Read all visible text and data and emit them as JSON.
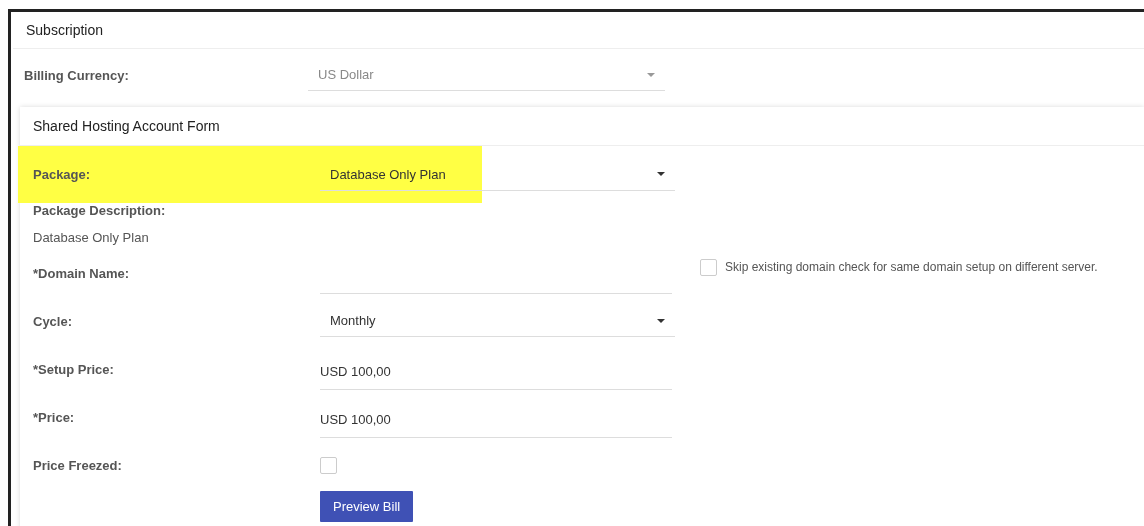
{
  "subscription": {
    "title": "Subscription",
    "billing": {
      "label": "Billing Currency:",
      "value": "US Dollar",
      "disabled": true
    }
  },
  "form": {
    "title": "Shared Hosting Account Form",
    "fields": [
      {
        "kind": "select",
        "label": "Package:",
        "value": "Database Only Plan",
        "highlighted": true
      },
      {
        "kind": "description",
        "label": "Package Description:",
        "value": "Database Only Plan"
      },
      {
        "kind": "input",
        "label": "*Domain Name:",
        "option": {
          "label": "Skip existing domain check for same domain setup on different server.",
          "checked": false
        }
      },
      {
        "kind": "select",
        "label": "Cycle:",
        "value": "Monthly",
        "highlighted": false
      },
      {
        "kind": "input",
        "label": "*Setup Price:",
        "value": "USD 100,00"
      },
      {
        "kind": "input",
        "label": "*Price:",
        "value": "USD 100,00"
      },
      {
        "kind": "checkbox",
        "label": "Price Freezed:",
        "checked": false
      },
      {
        "kind": "button",
        "label": "Preview Bill"
      }
    ]
  }
}
